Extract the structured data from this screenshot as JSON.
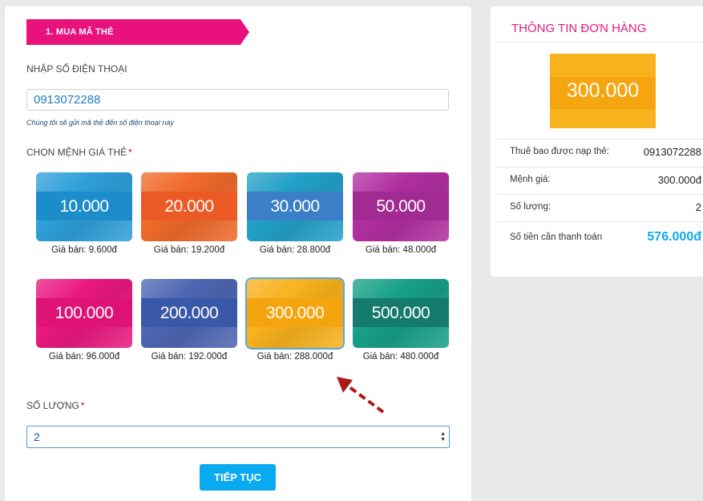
{
  "colors": {
    "brand": "#e8117e",
    "accent": "#0aaaf0",
    "total": "#0aaaf0"
  },
  "step": {
    "label": "1. MUA MÃ THẺ"
  },
  "phone": {
    "label": "NHẬP SỐ ĐIỆN THOẠI",
    "value": "0913072288",
    "note": "Chúng tôi sẽ gửi mã thẻ đến số điện thoại này"
  },
  "denomination": {
    "label": "CHỌN MỆNH GIÁ THẺ",
    "required_mark": "*"
  },
  "cards": [
    {
      "amount": "10.000",
      "price": "Giá bán: 9.600đ",
      "color": "#2e9fd8",
      "band": "#1d8ccb"
    },
    {
      "amount": "20.000",
      "price": "Giá bán: 19.200đ",
      "color": "#ef6a2a",
      "band": "#ec5a26"
    },
    {
      "amount": "30.000",
      "price": "Giá bán: 28.800đ",
      "color": "#22a0c8",
      "band": "#3a7fc7"
    },
    {
      "amount": "50.000",
      "price": "Giá bán: 48.000đ",
      "color": "#b12fa0",
      "band": "#a12b93"
    },
    {
      "amount": "100.000",
      "price": "Giá bán: 96.000đ",
      "color": "#e8187f",
      "band": "#df1276"
    },
    {
      "amount": "200.000",
      "price": "Giá bán: 192.000đ",
      "color": "#4d66b3",
      "band": "#3a58a8"
    },
    {
      "amount": "300.000",
      "price": "Giá bán: 288.000đ",
      "color": "#f7b21d",
      "band": "#f4a40e"
    },
    {
      "amount": "500.000",
      "price": "Giá bán: 480.000đ",
      "color": "#17a087",
      "band": "#157b6c"
    }
  ],
  "quantity": {
    "label": "SỐ LƯỢNG",
    "required_mark": "*",
    "value": "2"
  },
  "continue_label": "TIẾP TỤC",
  "order": {
    "title": "THÔNG TIN ĐƠN HÀNG",
    "card_amount": "300.000",
    "rows": [
      {
        "key": "Thuê bao được nạp thẻ:",
        "value": "0913072288"
      },
      {
        "key": "Mệnh giá:",
        "value": "300.000đ"
      },
      {
        "key": "Số lượng:",
        "value": "2"
      },
      {
        "key": "Số tiền cần thanh toán",
        "value": "576.000đ"
      }
    ]
  }
}
